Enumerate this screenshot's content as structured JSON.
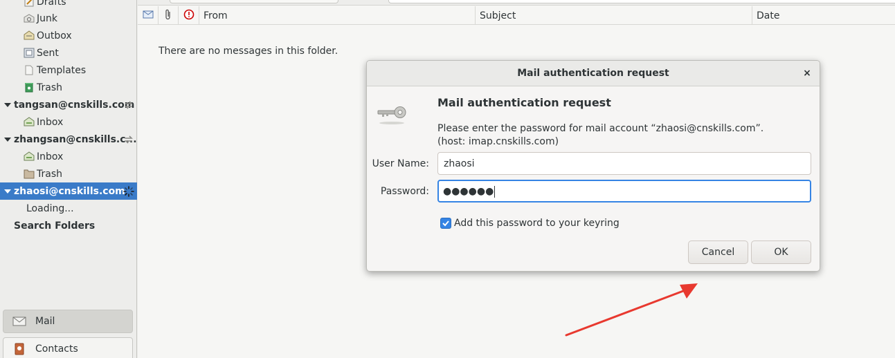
{
  "sidebar": {
    "items": [
      {
        "label": "Drafts",
        "icon": "drafts-icon"
      },
      {
        "label": "Junk",
        "icon": "junk-icon"
      },
      {
        "label": "Outbox",
        "icon": "outbox-icon"
      },
      {
        "label": "Sent",
        "icon": "sent-icon"
      },
      {
        "label": "Templates",
        "icon": "templates-icon"
      },
      {
        "label": "Trash",
        "icon": "trash-icon"
      },
      {
        "label": "tangsan@cnskills.com",
        "icon": "account-expander"
      },
      {
        "label": "Inbox",
        "icon": "inbox-icon"
      },
      {
        "label": "zhangsan@cnskills.c...",
        "icon": "account-expander"
      },
      {
        "label": "Inbox",
        "icon": "inbox-icon"
      },
      {
        "label": "Trash",
        "icon": "trash-icon"
      },
      {
        "label": "zhaosi@cnskills.com",
        "icon": "account-expander"
      },
      {
        "label": "Loading...",
        "icon": ""
      },
      {
        "label": "Search Folders",
        "icon": ""
      }
    ],
    "switcher": {
      "mail": "Mail",
      "contacts": "Contacts"
    }
  },
  "message_list": {
    "columns": {
      "from": "From",
      "subject": "Subject",
      "date": "Date"
    },
    "empty_text": "There are no messages in this folder."
  },
  "dialog": {
    "window_title": "Mail authentication request",
    "close_glyph": "×",
    "heading": "Mail authentication request",
    "description_line1": "Please enter the password for mail account “zhaosi@cnskills.com”.",
    "description_line2": "(host: imap.cnskills.com)",
    "username_label": "User Name:",
    "username_value": "zhaosi",
    "password_label": "Password:",
    "password_masked": "●●●●●●",
    "keyring_checkbox_label": "Add this password to your keyring",
    "keyring_checked": true,
    "cancel_label": "Cancel",
    "ok_label": "OK"
  },
  "colors": {
    "selection": "#3a7bc8",
    "focus": "#3584e4",
    "annotation_arrow": "#e8392f"
  }
}
